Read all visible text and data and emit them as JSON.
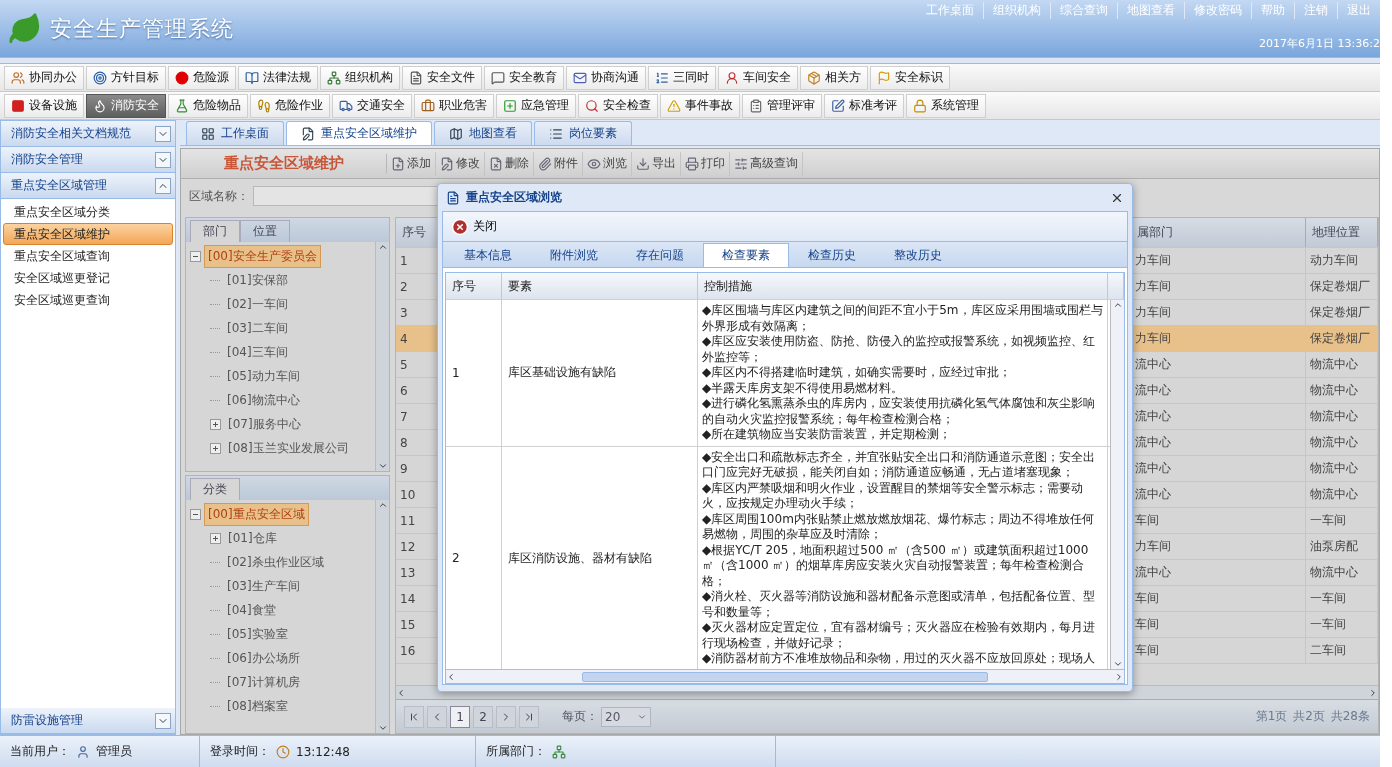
{
  "header": {
    "title": "安全生产管理系统",
    "links": [
      "工作桌面",
      "组织机构",
      "综合查询",
      "地图查看",
      "修改密码",
      "帮助",
      "注销",
      "退出"
    ],
    "datetime": "2017年6月1日 13:36:2"
  },
  "toolbar_rows": [
    [
      {
        "label": "协同办公",
        "selected": false
      },
      {
        "label": "方针目标",
        "selected": false
      },
      {
        "label": "危险源",
        "selected": false
      },
      {
        "label": "法律法规",
        "selected": false
      },
      {
        "label": "组织机构",
        "selected": false
      },
      {
        "label": "安全文件",
        "selected": false
      },
      {
        "label": "安全教育",
        "selected": false
      },
      {
        "label": "协商沟通",
        "selected": false
      },
      {
        "label": "三同时",
        "selected": false
      },
      {
        "label": "车间安全",
        "selected": false
      },
      {
        "label": "相关方",
        "selected": false
      },
      {
        "label": "安全标识",
        "selected": false
      }
    ],
    [
      {
        "label": "设备设施",
        "selected": false
      },
      {
        "label": "消防安全",
        "selected": true
      },
      {
        "label": "危险物品",
        "selected": false
      },
      {
        "label": "危险作业",
        "selected": false
      },
      {
        "label": "交通安全",
        "selected": false
      },
      {
        "label": "职业危害",
        "selected": false
      },
      {
        "label": "应急管理",
        "selected": false
      },
      {
        "label": "安全检查",
        "selected": false
      },
      {
        "label": "事件事故",
        "selected": false
      },
      {
        "label": "管理评审",
        "selected": false
      },
      {
        "label": "标准考评",
        "selected": false
      },
      {
        "label": "系统管理",
        "selected": false
      }
    ]
  ],
  "sidebar": {
    "sections": [
      {
        "title": "消防安全相关文档规范",
        "expanded": false
      },
      {
        "title": "消防安全管理",
        "expanded": false
      },
      {
        "title": "重点安全区域管理",
        "expanded": true,
        "items": [
          {
            "label": "重点安全区域分类",
            "selected": false
          },
          {
            "label": "重点安全区域维护",
            "selected": true
          },
          {
            "label": "重点安全区域查询",
            "selected": false
          },
          {
            "label": "安全区域巡更登记",
            "selected": false
          },
          {
            "label": "安全区域巡更查询",
            "selected": false
          }
        ]
      },
      {
        "title": "防雷设施管理",
        "expanded": false
      }
    ]
  },
  "tabs": [
    {
      "label": "工作桌面",
      "selected": false
    },
    {
      "label": "重点安全区域维护",
      "selected": true
    },
    {
      "label": "地图查看",
      "selected": false
    },
    {
      "label": "岗位要素",
      "selected": false
    }
  ],
  "panel": {
    "title": "重点安全区域维护",
    "actions": [
      "添加",
      "修改",
      "删除",
      "附件",
      "浏览",
      "导出",
      "打印",
      "高级查询"
    ]
  },
  "search": {
    "label": "区域名称："
  },
  "tree_panels": [
    {
      "tabs": [
        {
          "label": "部门",
          "selected": true
        },
        {
          "label": "位置",
          "selected": false
        }
      ],
      "tree": [
        {
          "label": "[00]安全生产委员会",
          "selected": true,
          "expanded": true,
          "children": [
            {
              "label": "[01]安保部",
              "selected": false
            },
            {
              "label": "[02]一车间",
              "selected": false
            },
            {
              "label": "[03]二车间",
              "selected": false
            },
            {
              "label": "[04]三车间",
              "selected": false
            },
            {
              "label": "[05]动力车间",
              "selected": false
            },
            {
              "label": "[06]物流中心",
              "selected": false
            },
            {
              "label": "[07]服务中心",
              "selected": false,
              "expanded": false
            },
            {
              "label": "[08]玉兰实业发展公司",
              "selected": false,
              "expanded": false
            }
          ]
        }
      ]
    },
    {
      "tabs": [
        {
          "label": "分类",
          "selected": true
        }
      ],
      "tree": [
        {
          "label": "[00]重点安全区域",
          "selected": true,
          "expanded": true,
          "children": [
            {
              "label": "[01]仓库",
              "selected": false,
              "expanded": false
            },
            {
              "label": "[02]杀虫作业区域",
              "selected": false
            },
            {
              "label": "[03]生产车间",
              "selected": false
            },
            {
              "label": "[04]食堂",
              "selected": false
            },
            {
              "label": "[05]实验室",
              "selected": false
            },
            {
              "label": "[06]办公场所",
              "selected": false
            },
            {
              "label": "[07]计算机房",
              "selected": false
            },
            {
              "label": "[08]档案室",
              "selected": false
            }
          ]
        }
      ]
    }
  ],
  "grid": {
    "columns": [
      "序号",
      "属部门",
      "地理位置"
    ],
    "rows": [
      {
        "cells": [
          "1",
          "力车间",
          "动力车间"
        ],
        "selected": false
      },
      {
        "cells": [
          "2",
          "力车间",
          "保定卷烟厂"
        ],
        "selected": false
      },
      {
        "cells": [
          "3",
          "力车间",
          "保定卷烟厂"
        ],
        "selected": false
      },
      {
        "cells": [
          "4",
          "力车间",
          "保定卷烟厂"
        ],
        "selected": true
      },
      {
        "cells": [
          "5",
          "流中心",
          "物流中心"
        ],
        "selected": false
      },
      {
        "cells": [
          "6",
          "流中心",
          "物流中心"
        ],
        "selected": false
      },
      {
        "cells": [
          "7",
          "流中心",
          "物流中心"
        ],
        "selected": false
      },
      {
        "cells": [
          "8",
          "流中心",
          "物流中心"
        ],
        "selected": false
      },
      {
        "cells": [
          "9",
          "流中心",
          "物流中心"
        ],
        "selected": false
      },
      {
        "cells": [
          "10",
          "流中心",
          "物流中心"
        ],
        "selected": false
      },
      {
        "cells": [
          "11",
          "车间",
          "一车间"
        ],
        "selected": false
      },
      {
        "cells": [
          "12",
          "力车间",
          "油泵房配"
        ],
        "selected": false
      },
      {
        "cells": [
          "13",
          "流中心",
          "物流中心"
        ],
        "selected": false
      },
      {
        "cells": [
          "14",
          "车间",
          "一车间"
        ],
        "selected": false
      },
      {
        "cells": [
          "15",
          "车间",
          "一车间"
        ],
        "selected": false
      },
      {
        "cells": [
          "16",
          "车间",
          "二车间"
        ],
        "selected": false
      }
    ]
  },
  "pager": {
    "pages": [
      {
        "label": "1",
        "selected": true
      },
      {
        "label": "2",
        "selected": false
      }
    ],
    "page_size_label": "每页：",
    "page_size": "20",
    "summary": "第1页  共2页  共28条"
  },
  "dialog": {
    "title": "重点安全区域浏览",
    "close_label": "关闭",
    "tabs": [
      {
        "label": "基本信息",
        "selected": false
      },
      {
        "label": "附件浏览",
        "selected": false
      },
      {
        "label": "存在问题",
        "selected": false
      },
      {
        "label": "检查要素",
        "selected": true
      },
      {
        "label": "检查历史",
        "selected": false
      },
      {
        "label": "整改历史",
        "selected": false
      }
    ],
    "columns": [
      "序号",
      "要素",
      "控制措施"
    ],
    "rows": [
      {
        "no": "1",
        "element": "库区基础设施有缺陷",
        "measures": [
          "◆库区围墙与库区内建筑之间的间距不宜小于5m，库区应采用围墙或围栏与外界形成有效隔离；",
          "◆库区应安装使用防盗、防抢、防侵入的监控或报警系统，如视频监控、红外监控等；",
          "◆库区内不得搭建临时建筑，如确实需要时，应经过审批；",
          "◆半露天库房支架不得使用易燃材料。",
          "◆进行磷化氢熏蒸杀虫的库房内，应安装使用抗磷化氢气体腐蚀和灰尘影响的自动火灾监控报警系统；每年检查检测合格；",
          "◆所在建筑物应当安装防雷装置，并定期检测；"
        ]
      },
      {
        "no": "2",
        "element": "库区消防设施、器材有缺陷",
        "measures": [
          "◆安全出口和疏散标志齐全，并宜张贴安全出口和消防通道示意图；安全出口门应完好无破损，能关闭自如；消防通道应畅通，无占道堵塞现象；",
          "◆库区内严禁吸烟和明火作业，设置醒目的禁烟等安全警示标志；需要动火，应按规定办理动火手续；",
          "◆库区周围100m内张贴禁止燃放燃放烟花、爆竹标志；周边不得堆放任何易燃物，周围的杂草应及时清除；",
          "◆根据YC/T 205，地面积超过500 ㎡（含500 ㎡）或建筑面积超过1000 ㎡（含1000 ㎡）的烟草库房应安装火灾自动报警装置；每年检查检测合格；",
          "◆消火栓、灭火器等消防设施和器材配备示意图或清单，包括配备位置、型号和数量等；",
          "◆灭火器材应定置定位，宜有器材编号；灭火器应在检验有效期内，每月进行现场检查，并做好记录；",
          "◆消防器材前方不准堆放物品和杂物，用过的灭火器不应放回原处；现场人"
        ]
      }
    ]
  },
  "status_bar": {
    "user_label": "当前用户：",
    "user": "管理员",
    "login_label": "登录时间：",
    "login_time": "13:12:48",
    "dept_label": "所属部门："
  }
}
